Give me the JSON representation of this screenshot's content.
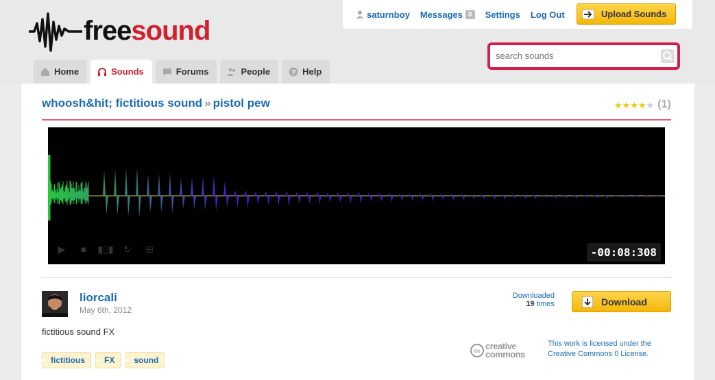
{
  "logo": {
    "text_free": "free",
    "text_sound": "sound"
  },
  "userbar": {
    "username": "saturnboy",
    "messages_label": "Messages",
    "messages_count": "0",
    "settings_label": "Settings",
    "logout_label": "Log Out"
  },
  "upload_button": {
    "label": "Upload Sounds"
  },
  "search": {
    "placeholder": "search sounds"
  },
  "tabs": [
    {
      "label": "Home",
      "icon": "home-icon"
    },
    {
      "label": "Sounds",
      "icon": "headphones-icon",
      "active": true
    },
    {
      "label": "Forums",
      "icon": "speech-bubble-icon"
    },
    {
      "label": "People",
      "icon": "people-icon"
    },
    {
      "label": "Help",
      "icon": "question-icon"
    }
  ],
  "sound": {
    "pack": "whoosh&hit; fictitious sound",
    "separator": "»",
    "name": "pistol pew",
    "rating_stars": 4,
    "rating_count": "(1)",
    "timer": "-00:08:308",
    "author": "liorcali",
    "date": "May 6th, 2012",
    "description": "fictitious sound FX",
    "tags": [
      "fictitious",
      "FX",
      "sound"
    ],
    "downloaded_label": "Downloaded",
    "download_count": "19",
    "download_unit": "times",
    "download_label": "Download",
    "cc_text_line1": "creative",
    "cc_text_line2": "commons",
    "cc_logo": "cc",
    "license": "This work is licensed under the Creative Commons 0 License."
  },
  "colors": {
    "brand_red": "#d1202f",
    "link_blue": "#1a6bb5",
    "button_yellow": "#f3b70a"
  }
}
